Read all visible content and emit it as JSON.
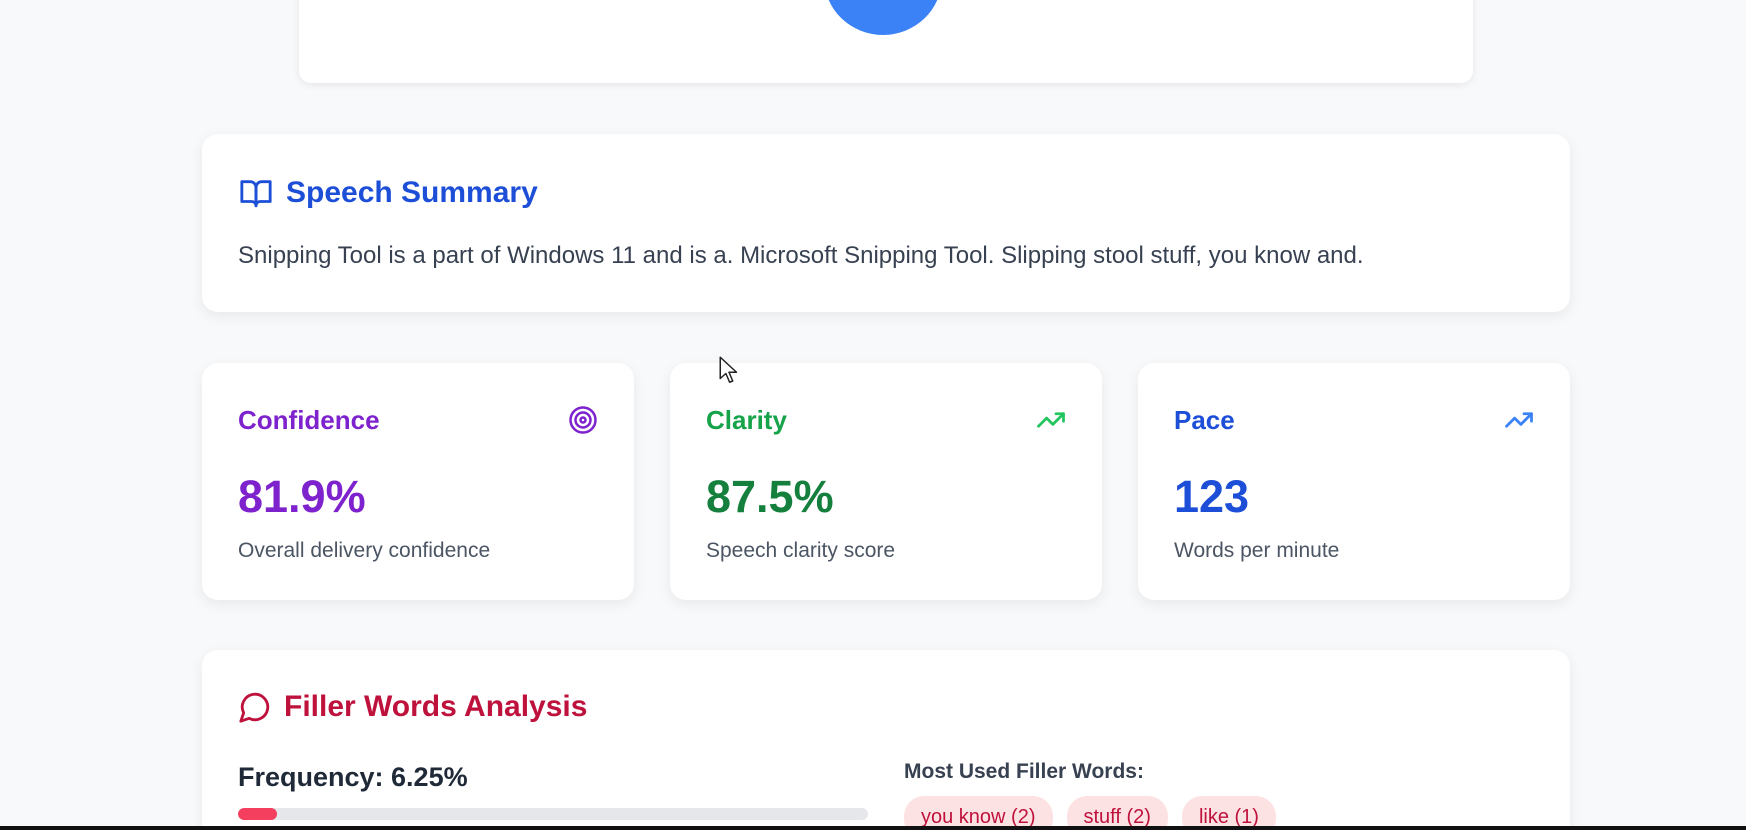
{
  "colors": {
    "confidence": "#7e22ce",
    "clarity": "#15803d",
    "pace": "#1d4ed8",
    "filler": "#be123c",
    "summary": "#1d4ed8",
    "top_circle": "#3b82f6"
  },
  "summary": {
    "title": "Speech Summary",
    "icon": "book-open-icon",
    "text": "Snipping Tool is a part of Windows 11 and is a. Microsoft Snipping Tool. Slipping stool stuff, you know and."
  },
  "metrics": [
    {
      "label": "Confidence",
      "value": "81.9%",
      "description": "Overall delivery confidence",
      "icon": "target-icon"
    },
    {
      "label": "Clarity",
      "value": "87.5%",
      "description": "Speech clarity score",
      "icon": "trending-up-icon"
    },
    {
      "label": "Pace",
      "value": "123",
      "description": "Words per minute",
      "icon": "trending-up-icon"
    }
  ],
  "filler": {
    "title": "Filler Words Analysis",
    "icon": "message-circle-icon",
    "frequency_label": "Frequency: 6.25%",
    "frequency_percent": 6.25,
    "most_used_label": "Most Used Filler Words:",
    "words": [
      {
        "text": "you know (2)"
      },
      {
        "text": "stuff (2)"
      },
      {
        "text": "like (1)"
      }
    ]
  }
}
